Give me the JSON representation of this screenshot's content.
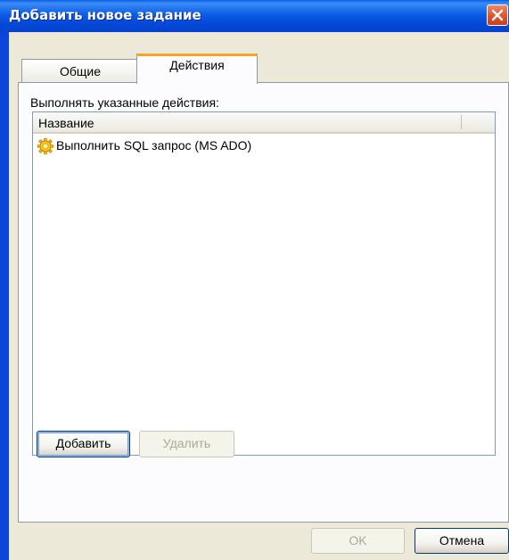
{
  "window": {
    "title": "Добавить новое задание"
  },
  "tabs": [
    {
      "label": "Общие",
      "active": false
    },
    {
      "label": "Действия",
      "active": true
    }
  ],
  "actions_panel": {
    "label": "Выполнять указанные действия:",
    "list": {
      "column_header": "Название",
      "items": [
        {
          "icon": "gear-icon",
          "text": "Выполнить SQL запрос (MS ADO)"
        }
      ]
    },
    "add_button": "Добавить",
    "delete_button": "Удалить"
  },
  "dialog_buttons": {
    "ok": "OK",
    "cancel": "Отмена"
  },
  "colors": {
    "titlebar": "#0548d8",
    "client_bg": "#ece9d8",
    "tab_highlight": "#f7a42a",
    "close_button": "#e0542c"
  }
}
